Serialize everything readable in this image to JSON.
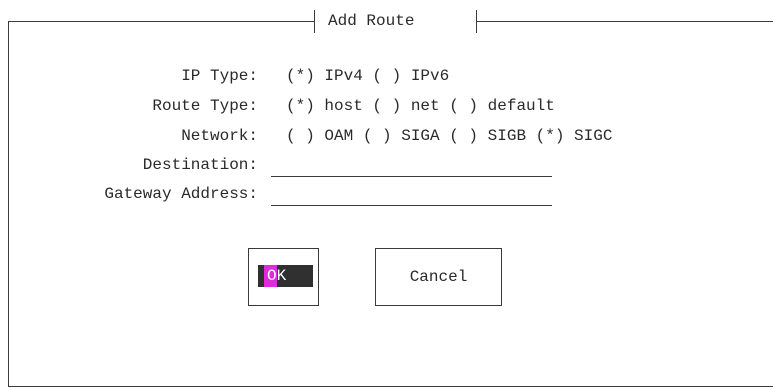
{
  "dialog": {
    "title": "Add Route"
  },
  "form": {
    "ip_type": {
      "label": "IP Type:",
      "options": "(*) IPv4 ( ) IPv6"
    },
    "route_type": {
      "label": "Route Type:",
      "options": "(*) host ( ) net ( ) default"
    },
    "network": {
      "label": "Network:",
      "options": "( ) OAM ( ) SIGA ( ) SIGB (*) SIGC"
    },
    "destination": {
      "label": "Destination:",
      "value": ""
    },
    "gateway": {
      "label": "Gateway Address:",
      "value": ""
    }
  },
  "buttons": {
    "ok_label": "OK",
    "cancel_label": "Cancel"
  },
  "colors": {
    "cursor": "#e02ae0",
    "focus_bg": "#303030"
  }
}
